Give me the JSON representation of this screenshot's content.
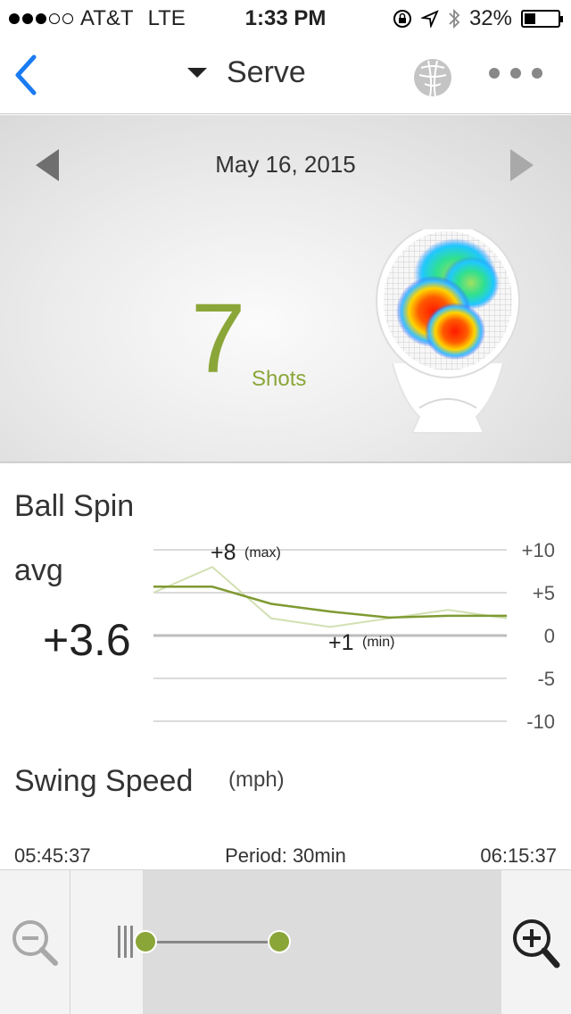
{
  "status_bar": {
    "carrier": "AT&T",
    "network": "LTE",
    "time": "1:33 PM",
    "battery": "32%",
    "battery_level": 0.32,
    "signal_bars_filled": 3,
    "signal_bars_total": 5
  },
  "nav": {
    "back_icon": "chevron-left-icon",
    "title": "Serve",
    "dropdown_icon": "caret-down-icon",
    "racket_icon": "racket-icon",
    "more_icon": "more-dots-icon",
    "accent_color": "#1a7bf2"
  },
  "summary": {
    "date": "May 16, 2015",
    "shot_count": "7",
    "shot_label": "Shots",
    "accent_color": "#8ba638"
  },
  "ball_spin": {
    "title": "Ball Spin",
    "avg_label": "avg",
    "avg_value": "+3.6",
    "max_label": "+8",
    "max_suffix": "(max)",
    "min_label": "+1",
    "min_suffix": "(min)",
    "y_ticks": [
      "+10",
      "+5",
      "0",
      "-5",
      "-10"
    ]
  },
  "chart_data": {
    "type": "line",
    "title": "Ball Spin",
    "xlabel": "",
    "ylabel": "",
    "ylim": [
      -10,
      10
    ],
    "yticks": [
      10,
      5,
      0,
      -5,
      -10
    ],
    "grid": true,
    "x": [
      1,
      2,
      3,
      4,
      5,
      6,
      7
    ],
    "series": [
      {
        "values": [
          5,
          8,
          2,
          1,
          2,
          3,
          2
        ],
        "color": "#d2e0b2"
      },
      {
        "values": [
          5.7,
          5.7,
          3.7,
          2.8,
          2.1,
          2.3,
          2.3
        ],
        "color": "#7f9a32"
      }
    ],
    "annotations": [
      {
        "text": "+8 (max)",
        "x": 2,
        "y": 8
      },
      {
        "text": "+1 (min)",
        "x": 4,
        "y": 1
      }
    ]
  },
  "swing_speed": {
    "title": "Swing Speed",
    "unit": "(mph)"
  },
  "timeline": {
    "start_time": "05:45:37",
    "period": "Period: 30min",
    "end_time": "06:15:37",
    "zoom_out_icon": "zoom-out-icon",
    "zoom_in_icon": "zoom-in-icon"
  }
}
